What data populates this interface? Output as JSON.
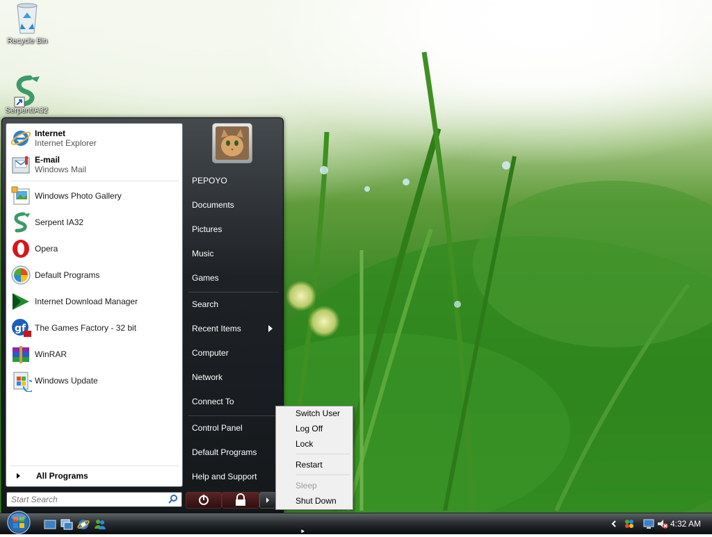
{
  "desktop": {
    "icons": [
      {
        "label": "Recycle Bin",
        "icon": "recycle-bin-icon"
      },
      {
        "label": "SerpentIA32",
        "icon": "serpent-icon"
      }
    ]
  },
  "start_menu": {
    "pinned": [
      {
        "title": "Internet",
        "subtitle": "Internet Explorer",
        "icon": "internet-explorer-icon"
      },
      {
        "title": "E-mail",
        "subtitle": "Windows Mail",
        "icon": "windows-mail-icon"
      }
    ],
    "recent": [
      {
        "label": "Windows Photo Gallery",
        "icon": "photo-gallery-icon"
      },
      {
        "label": "Serpent IA32",
        "icon": "serpent-icon"
      },
      {
        "label": "Opera",
        "icon": "opera-icon"
      },
      {
        "label": "Default Programs",
        "icon": "default-programs-icon"
      },
      {
        "label": "Internet Download Manager",
        "icon": "download-manager-icon"
      },
      {
        "label": "The Games Factory - 32 bit",
        "icon": "games-factory-icon"
      },
      {
        "label": "WinRAR",
        "icon": "winrar-icon"
      },
      {
        "label": "Windows Update",
        "icon": "windows-update-icon"
      }
    ],
    "all_programs": "All Programs",
    "search_placeholder": "Start Search",
    "right_pane": {
      "user": "PEPOYO",
      "items": [
        "Documents",
        "Pictures",
        "Music",
        "Games",
        "Search",
        "Recent Items",
        "Computer",
        "Network",
        "Connect To",
        "Control Panel",
        "Default Programs",
        "Help and Support"
      ]
    }
  },
  "power_menu": {
    "items": [
      {
        "label": "Switch User",
        "enabled": true
      },
      {
        "label": "Log Off",
        "enabled": true
      },
      {
        "label": "Lock",
        "enabled": true
      },
      {
        "label": "Restart",
        "enabled": true
      },
      {
        "label": "Sleep",
        "enabled": false
      },
      {
        "label": "Shut Down",
        "enabled": true
      }
    ]
  },
  "taskbar": {
    "clock": "4:32 AM",
    "quick_launch": [
      "show-desktop-icon",
      "switch-windows-icon",
      "internet-explorer-icon",
      "messenger-icon"
    ],
    "tray": [
      "chevron-left-icon",
      "network-tray-icon",
      "display-tray-icon",
      "volume-muted-icon"
    ]
  },
  "colors": {
    "start_menu_dark": "#1e2226",
    "power_button_red": "#5a2424",
    "wallpaper_green": "#3f8a28"
  }
}
